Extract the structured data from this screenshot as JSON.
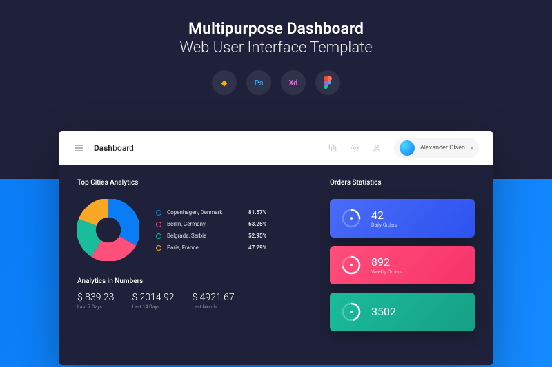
{
  "hero": {
    "title": "Multipurpose Dashboard",
    "subtitle": "Web User Interface Template"
  },
  "tools": [
    "sketch",
    "photoshop",
    "xd",
    "figma"
  ],
  "header": {
    "brand_bold": "Dash",
    "brand_light": "board",
    "user_name": "Alexander Olsen"
  },
  "analytics": {
    "title": "Top Cities Analytics",
    "items": [
      {
        "city": "Copenhagen, Denmark",
        "value": "81.57%",
        "color": "#0a7cf5"
      },
      {
        "city": "Berlin, Germany",
        "value": "63.25%",
        "color": "#ff4f7b"
      },
      {
        "city": "Belgrade, Serbia",
        "value": "52.95%",
        "color": "#1abc9c"
      },
      {
        "city": "Paris, France",
        "value": "47.29%",
        "color": "#f9a825"
      }
    ]
  },
  "numbers": {
    "title": "Analytics in Numbers",
    "items": [
      {
        "value": "$ 839.23",
        "label": "Last 7 Days"
      },
      {
        "value": "$ 2014.92",
        "label": "Last 14 Days"
      },
      {
        "value": "$ 4921.67",
        "label": "Last Month"
      }
    ]
  },
  "orders": {
    "title": "Orders Statistics",
    "cards": [
      {
        "value": "42",
        "label": "Daily Orders",
        "pct": 25
      },
      {
        "value": "892",
        "label": "Weekly Orders",
        "pct": 70
      },
      {
        "value": "3502",
        "label": "",
        "pct": 45
      }
    ]
  },
  "chart_data": {
    "type": "pie",
    "title": "Top Cities Analytics",
    "series": [
      {
        "name": "Copenhagen, Denmark",
        "value": 81.57,
        "color": "#0a7cf5"
      },
      {
        "name": "Berlin, Germany",
        "value": 63.25,
        "color": "#ff4f7b"
      },
      {
        "name": "Belgrade, Serbia",
        "value": 52.95,
        "color": "#1abc9c"
      },
      {
        "name": "Paris, France",
        "value": 47.29,
        "color": "#f9a825"
      }
    ]
  }
}
